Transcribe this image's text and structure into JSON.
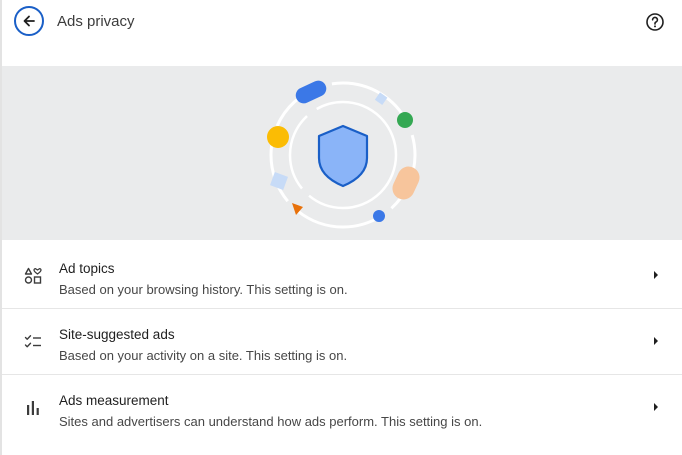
{
  "header": {
    "title": "Ads privacy",
    "back_icon": "arrow-left-icon",
    "help_icon": "help-circle-icon"
  },
  "hero": {
    "illustration": "shield-illustration"
  },
  "items": [
    {
      "title": "Ad topics",
      "subtitle": "Based on your browsing history. This setting is on.",
      "icon": "ad-topics-icon"
    },
    {
      "title": "Site-suggested ads",
      "subtitle": "Based on your activity on a site. This setting is on.",
      "icon": "checklist-icon"
    },
    {
      "title": "Ads measurement",
      "subtitle": "Sites and advertisers can understand how ads perform. This setting is on.",
      "icon": "bar-chart-icon"
    }
  ],
  "colors": {
    "accent": "#1a5fc7",
    "hero_bg": "#eaebec",
    "shield_fill": "#8ab4f8"
  }
}
